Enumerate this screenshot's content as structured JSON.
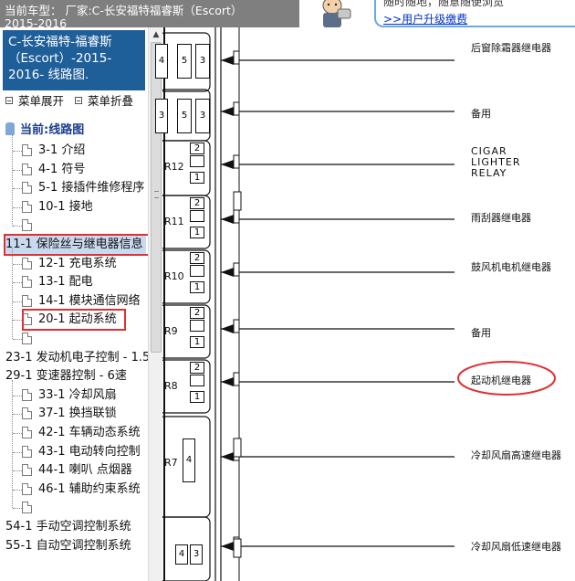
{
  "topbar": {
    "line1": "当前车型： 厂家:C-长安福特福睿斯（Escort）",
    "line2": "2015-2016",
    "promo_line1": "随时随地，随意随便浏览",
    "promo_link": ">>用户升级缴费"
  },
  "sidebar": {
    "vehicle": [
      "C-长安福特-福睿斯",
      "（Escort）-2015-",
      "2016- 线路图."
    ],
    "expand_label": "菜单展开",
    "collapse_label": "菜单折叠",
    "root_label": "当前:线路图",
    "items": [
      {
        "label": "3-1 介绍",
        "level": "child"
      },
      {
        "label": "4-1 符号",
        "level": "child"
      },
      {
        "label": "5-1 接插件维修程序",
        "level": "child"
      },
      {
        "label": "10-1 接地",
        "level": "child"
      },
      {
        "label": "",
        "level": "child"
      },
      {
        "label": "11-1 保险丝与继电器信息",
        "level": "group"
      },
      {
        "label": "12-1 充电系统",
        "level": "child"
      },
      {
        "label": "13-1 配电",
        "level": "child"
      },
      {
        "label": "14-1 模块通信网络",
        "level": "child"
      },
      {
        "label": "20-1 起动系统",
        "level": "child"
      },
      {
        "label": "",
        "level": "child"
      },
      {
        "label": "23-1 发动机电子控制 - 1.5",
        "level": "group"
      },
      {
        "label": "29-1 变速器控制 - 6速",
        "level": "group"
      },
      {
        "label": "33-1 冷却风扇",
        "level": "child"
      },
      {
        "label": "37-1 换挡联锁",
        "level": "child"
      },
      {
        "label": "42-1 车辆动态系统",
        "level": "child"
      },
      {
        "label": "43-1 电动转向控制",
        "level": "child"
      },
      {
        "label": "44-1 喇叭 点烟器",
        "level": "child"
      },
      {
        "label": "46-1 辅助约束系统",
        "level": "child"
      },
      {
        "label": "",
        "level": "child"
      },
      {
        "label": "54-1 手动空调控制系统",
        "level": "group"
      },
      {
        "label": "55-1 自动空调控制系统",
        "level": "group"
      }
    ]
  },
  "diagram": {
    "relays": [
      {
        "id": "r-rear-defrost",
        "label": "后窗除霜器继电器",
        "pins": [
          "4",
          "5",
          "3"
        ]
      },
      {
        "id": "r-spare1",
        "label": "备用",
        "pins": [
          "3",
          "5",
          "3"
        ]
      },
      {
        "id": "r-cigar",
        "label": "CIGAR\nLIGHTER\nRELAY",
        "name": "R12",
        "pins": [
          "2",
          "",
          "1"
        ]
      },
      {
        "id": "r-wiper",
        "label": "雨刮器继电器",
        "name": "R11",
        "pins": [
          "2",
          "",
          "1"
        ]
      },
      {
        "id": "r-blower",
        "label": "鼓风机电机继电器",
        "name": "R10",
        "pins": [
          "2",
          "",
          "1"
        ]
      },
      {
        "id": "r-spare2",
        "label": "备用",
        "name": "R9",
        "pins": [
          "2",
          "",
          "1"
        ]
      },
      {
        "id": "r-starter",
        "label": "起动机继电器",
        "name": "R8",
        "pins": [
          "2",
          "",
          "1"
        ]
      },
      {
        "id": "r-fan-high",
        "label": "冷却风扇高速继电器",
        "name": "R7",
        "pins": [
          "4"
        ]
      },
      {
        "id": "r-fan-low",
        "label": "冷却风扇低速继电器",
        "pins": [
          "4",
          "3"
        ]
      }
    ]
  },
  "colors": {
    "highlight": "#e03030",
    "sidebar_header_bg": "#1f5f99",
    "topbar_bg": "#7f7f7f",
    "link": "#0033cc"
  }
}
